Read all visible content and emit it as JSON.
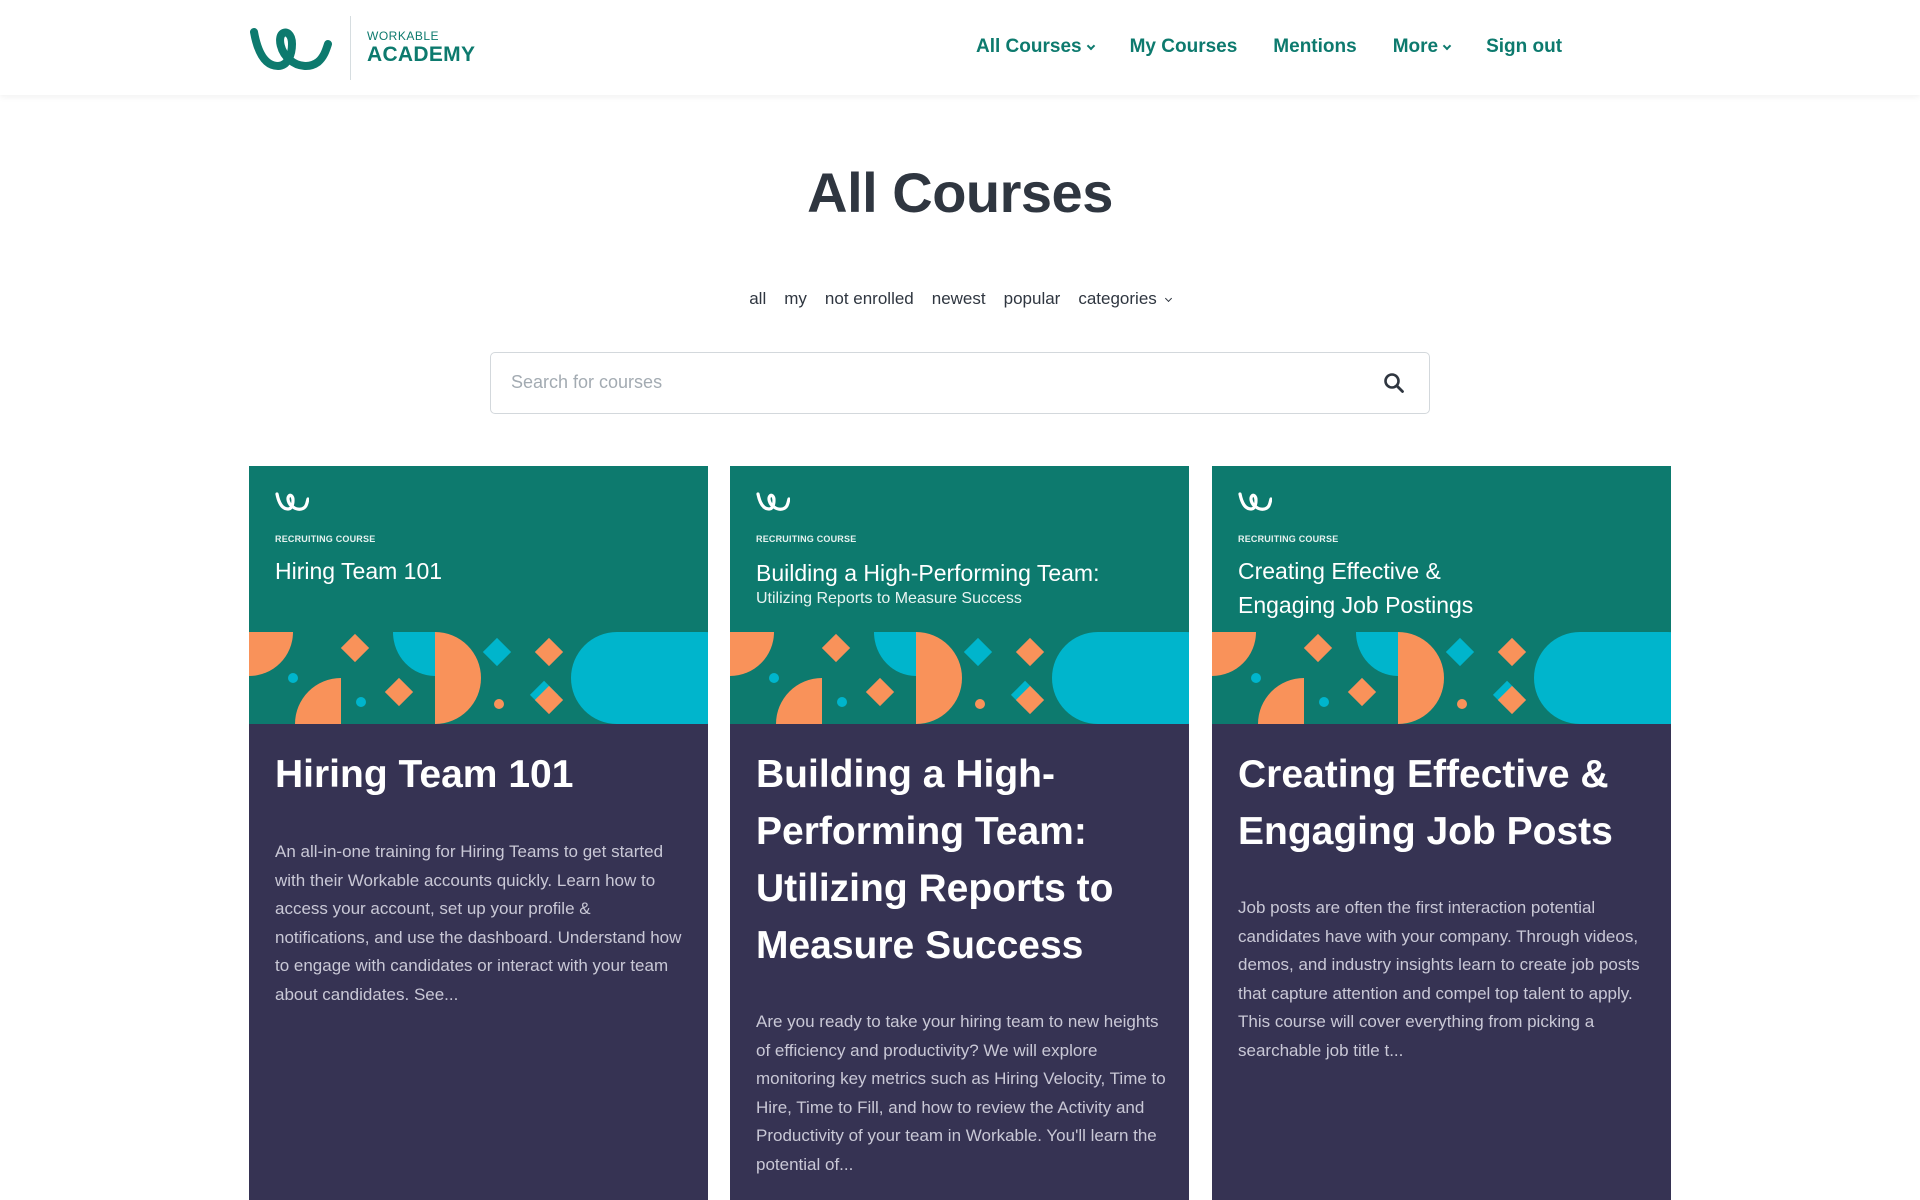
{
  "header": {
    "logo": {
      "small": "WORKABLE",
      "big": "ACADEMY"
    },
    "nav": [
      {
        "label": "All Courses"
      },
      {
        "label": "My Courses"
      },
      {
        "label": "Mentions"
      },
      {
        "label": "More"
      },
      {
        "label": "Sign out"
      }
    ]
  },
  "page": {
    "title": "All Courses"
  },
  "filters": [
    {
      "label": "all"
    },
    {
      "label": "my"
    },
    {
      "label": "not enrolled"
    },
    {
      "label": "newest"
    },
    {
      "label": "popular"
    },
    {
      "label": "categories"
    }
  ],
  "search": {
    "placeholder": "Search for courses"
  },
  "courses": [
    {
      "banner_tag": "RECRUITING COURSE",
      "banner_title": "Hiring Team 101",
      "banner_sub": "",
      "title": "Hiring Team 101",
      "description": "An all-in-one training for Hiring Teams to get started with their Workable accounts quickly. Learn how to access your account, set up your profile & notifications, and use the dashboard. Understand how to engage with candidates or interact with your team about candidates. See..."
    },
    {
      "banner_tag": "RECRUITING COURSE",
      "banner_title": "Building a High-Performing Team:",
      "banner_sub": "Utilizing Reports to Measure Success",
      "title": "Building a High-Performing Team: Utilizing Reports to Measure Success",
      "description": "Are you ready to take your hiring team to new heights of efficiency and productivity? We will explore monitoring key metrics such as Hiring Velocity, Time to Hire, Time to Fill, and how to review the Activity and Productivity of your team in Workable. You'll learn the potential of..."
    },
    {
      "banner_tag": "RECRUITING COURSE",
      "banner_title": "Creating Effective & Engaging Job Postings",
      "banner_sub": "",
      "title": "Creating Effective & Engaging Job Posts",
      "description": "Job posts are often the first interaction potential candidates have with your company. Through videos, demos, and industry insights learn to create job posts that capture attention and compel top talent to apply. This course will cover everything from picking a searchable job title t..."
    }
  ],
  "colors": {
    "brand_teal": "#0d7a6e",
    "card_navy": "#363353",
    "accent_orange": "#f9925a",
    "accent_cyan": "#00b5cc"
  },
  "icons": {
    "logo": "workable-logo-icon",
    "search": "search-icon",
    "chevron": "chevron-down-icon"
  }
}
